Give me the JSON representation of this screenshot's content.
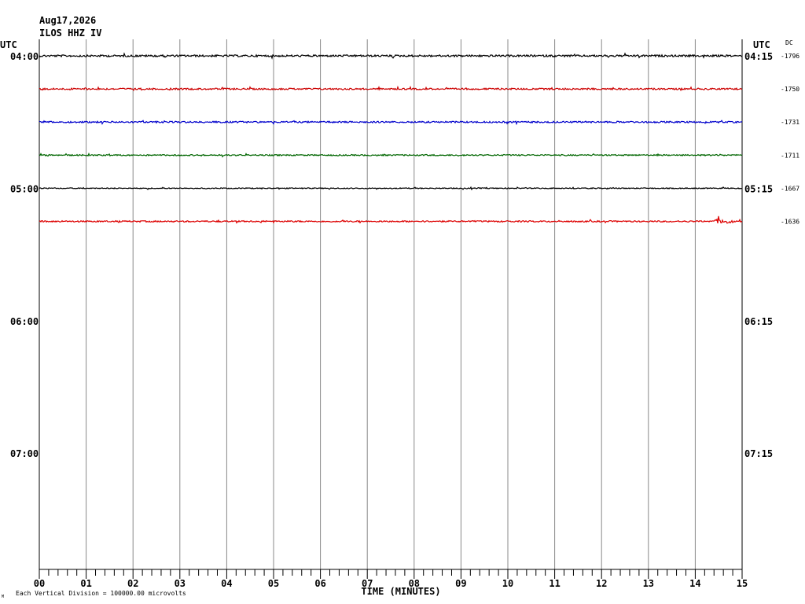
{
  "header": {
    "date": "Aug17,2026",
    "station": "ILOS HHZ IV"
  },
  "footer": {
    "note": "Each Vertical Division = 100000.00 microvolts",
    "mark": "M"
  },
  "chart_data": {
    "type": "line",
    "title": "",
    "xlabel": "TIME (MINUTES)",
    "ylabel": "",
    "xlim": [
      0,
      15
    ],
    "x_tick_labels": [
      "00",
      "01",
      "02",
      "03",
      "04",
      "05",
      "06",
      "07",
      "08",
      "09",
      "10",
      "11",
      "12",
      "13",
      "14",
      "15"
    ],
    "left_axis_title": "UTC",
    "right_axis_title": "UTC",
    "dc_title": "DC",
    "left_hour_labels": [
      {
        "row": 0,
        "text": "04:00"
      },
      {
        "row": 4,
        "text": "05:00"
      },
      {
        "row": 8,
        "text": "06:00"
      },
      {
        "row": 12,
        "text": "07:00"
      }
    ],
    "right_hour_labels": [
      {
        "row": 0,
        "text": "04:15"
      },
      {
        "row": 4,
        "text": "05:15"
      },
      {
        "row": 8,
        "text": "06:15"
      },
      {
        "row": 12,
        "text": "07:15"
      }
    ],
    "rows_total": 16,
    "series": [
      {
        "row": 0,
        "dc": "-1796",
        "color": "#000000",
        "amplitude": 1.2,
        "burst_x": null
      },
      {
        "row": 1,
        "dc": "-1750",
        "color": "#cc0000",
        "amplitude": 1.0,
        "burst_x": null
      },
      {
        "row": 2,
        "dc": "-1731",
        "color": "#0000cc",
        "amplitude": 1.0,
        "burst_x": null
      },
      {
        "row": 3,
        "dc": "-1711",
        "color": "#006600",
        "amplitude": 0.8,
        "burst_x": null
      },
      {
        "row": 4,
        "dc": "-1667",
        "color": "#000000",
        "amplitude": 0.6,
        "burst_x": null
      },
      {
        "row": 5,
        "dc": "-1636",
        "color": "#dd0000",
        "amplitude": 0.9,
        "burst_x": 14.6
      }
    ]
  }
}
